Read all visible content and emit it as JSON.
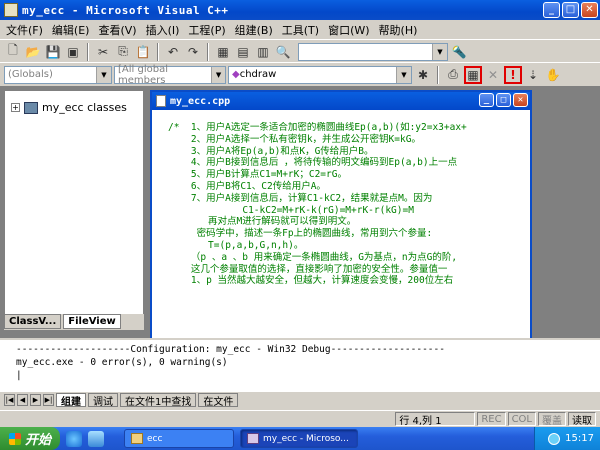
{
  "window": {
    "title": "my_ecc - Microsoft Visual C++"
  },
  "menu": [
    "文件(F)",
    "编辑(E)",
    "查看(V)",
    "插入(I)",
    "工程(P)",
    "组建(B)",
    "工具(T)",
    "窗口(W)",
    "帮助(H)"
  ],
  "wizard_bar": {
    "class_combo": "(Globals)",
    "members_combo": "[All global members",
    "function_combo": "chdraw"
  },
  "classview": {
    "root_item": "my_ecc classes",
    "tabs": [
      "ClassV...",
      "FileView"
    ]
  },
  "editor": {
    "title": "my_ecc.cpp",
    "lines": [
      "/*  1、用户A选定一条适合加密的椭圆曲线Ep(a,b)(如:y2=x3+ax+",
      "    2、用户A选择一个私有密钥k，并生成公开密钥K=kG。",
      "    3、用户A将Ep(a,b)和点K，G传给用户B。",
      "    4、用户B接到信息后 ，将待传输的明文编码到Ep(a,b)上一点",
      "    5、用户B计算点C1=M+rK；C2=rG。",
      "    6、用户B将C1、C2传给用户A。",
      "    7、用户A接到信息后，计算C1-kC2，结果就是点M。因为",
      "             C1-kC2=M+rK-k(rG)=M+rK-r(kG)=M",
      "       再对点M进行解码就可以得到明文。",
      "",
      "     密码学中，描述一条Fp上的椭圆曲线，常用到六个参量:",
      "       T=(p,a,b,G,n,h)。",
      "    （p 、a 、b 用来确定一条椭圆曲线，G为基点，n为点G的阶,",
      "",
      "    这几个参量取值的选择，直接影响了加密的安全性。参量值一",
      "",
      "    1、p 当然越大越安全，但越大，计算速度会变慢，200位左右"
    ]
  },
  "output": {
    "lines": [
      "--------------------Configuration: my_ecc - Win32 Debug--------------------",
      "",
      "my_ecc.exe - 0 error(s), 0 warning(s)"
    ],
    "tabs": [
      "组建",
      "调试",
      "在文件1中查找",
      "在文件"
    ]
  },
  "statusbar": {
    "position": "行 4,列 1",
    "rec": "REC",
    "col": "COL",
    "ovr": "覆盖",
    "read": "读取"
  },
  "taskbar": {
    "start": "开始",
    "tasks": [
      "ecc",
      "my_ecc - Microso..."
    ],
    "clock": "15:17"
  }
}
